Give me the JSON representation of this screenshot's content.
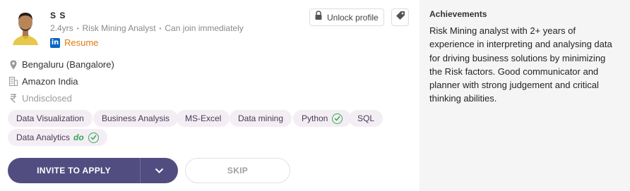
{
  "candidate": {
    "name": "S S",
    "experience": "2.4yrs",
    "role": "Risk Mining Analyst",
    "availability": "Can join immediately",
    "resume_label": "Resume",
    "linkedin_icon_text": "in"
  },
  "actions": {
    "unlock_label": "Unlock profile",
    "invite_label": "INVITE TO APPLY",
    "skip_label": "SKIP"
  },
  "details": {
    "location": "Bengaluru (Bangalore)",
    "company": "Amazon India",
    "salary": "Undisclosed"
  },
  "skills": [
    {
      "label": "Data Visualization",
      "verified": false
    },
    {
      "label": "Business Analysis",
      "verified": false
    },
    {
      "label": "MS-Excel",
      "verified": false
    },
    {
      "label": "Data mining",
      "verified": false
    },
    {
      "label": "Python",
      "verified": true
    },
    {
      "label": "SQL",
      "verified": false
    },
    {
      "label": "Data Analytics",
      "verified": true,
      "badge": "do"
    }
  ],
  "achievements": {
    "title": "Achievements",
    "text": "Risk Mining analyst with 2+ years of experience in interpreting and analysing data for driving business solutions by minimizing the Risk factors. Good communicator and planner with strong judgement and critical thinking abilities."
  },
  "icons": {
    "location": "map-pin-icon",
    "company": "building-icon",
    "salary": "rupee-icon",
    "unlock": "lock-icon",
    "tag": "tag-icon",
    "verified": "check-circle-icon",
    "dropdown": "chevron-down-icon"
  },
  "colors": {
    "primary": "#514d80",
    "chip_bg": "#f3eef4",
    "resume_link": "#e07a12",
    "verified": "#35a852",
    "linkedin": "#0a66c2",
    "side_panel": "#f5f5f6"
  }
}
